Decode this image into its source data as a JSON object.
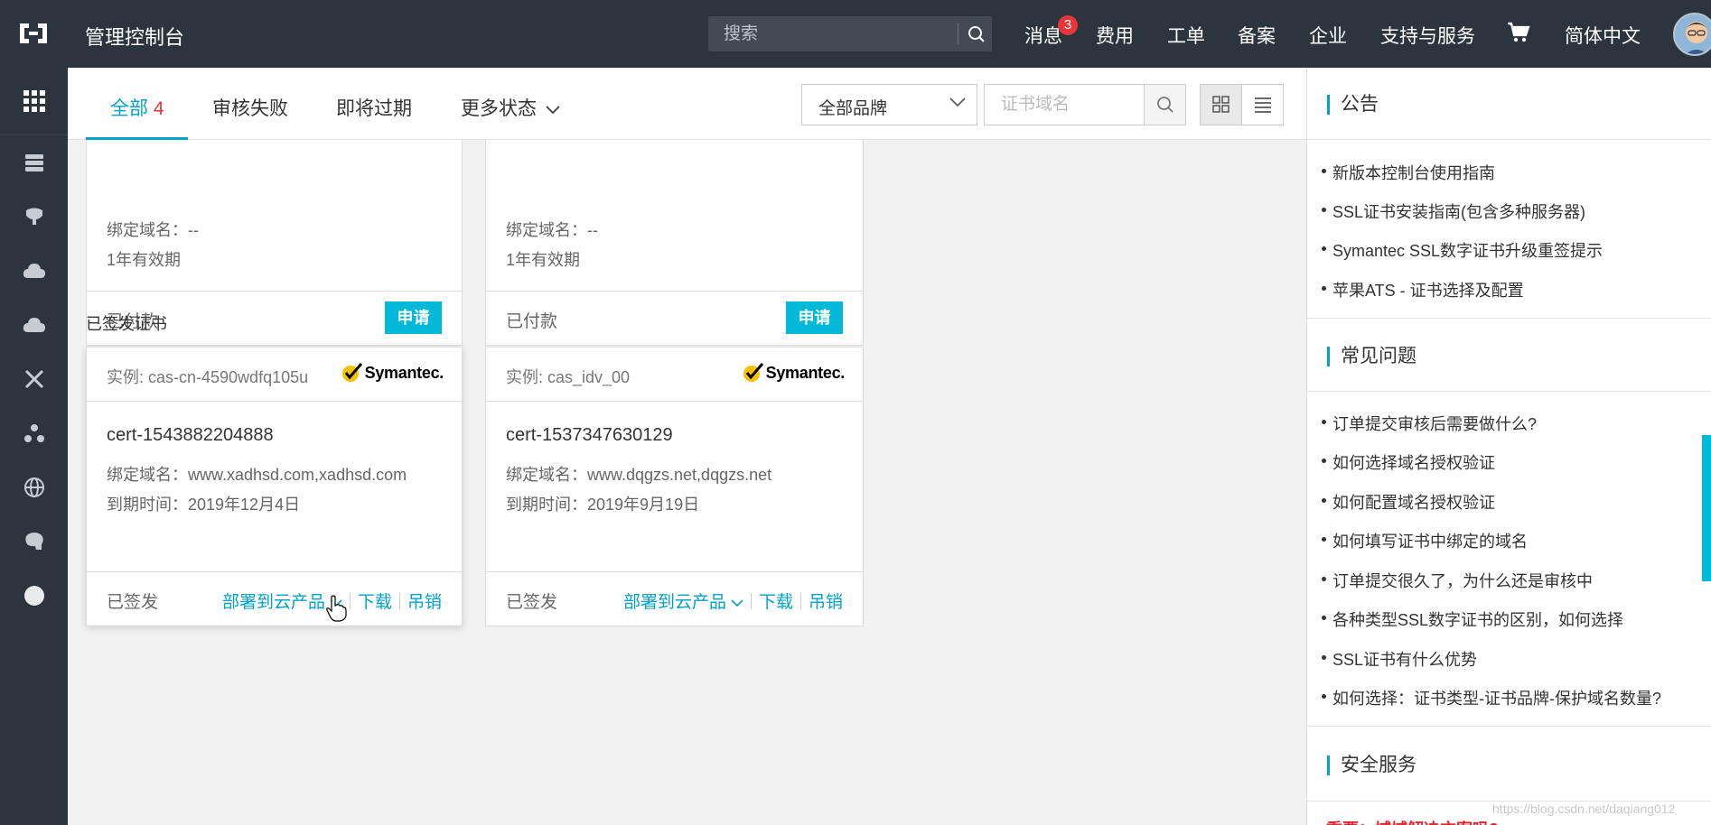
{
  "header": {
    "title": "管理控制台",
    "search_placeholder": "搜索",
    "nav": [
      "消息",
      "费用",
      "工单",
      "备案",
      "企业",
      "支持与服务",
      "简体中文"
    ],
    "message_count": "3"
  },
  "toolbar": {
    "tabs": [
      {
        "label": "全部",
        "count": "4"
      },
      {
        "label": "审核失败"
      },
      {
        "label": "即将过期"
      },
      {
        "label": "更多状态"
      }
    ],
    "brand_select": "全部品牌",
    "domain_placeholder": "证书域名"
  },
  "pending_cards": [
    {
      "domain_line": "绑定域名：--",
      "validity": "1年有效期",
      "status": "已付款",
      "action": "申请"
    },
    {
      "domain_line": "绑定域名：--",
      "validity": "1年有效期",
      "status": "已付款",
      "action": "申请"
    }
  ],
  "issued_section_label": "已签发证书",
  "issued_cards": [
    {
      "instance": "实例: cas-cn-4590wdfq105u",
      "brand": "Symantec.",
      "cert_name": "cert-1543882204888",
      "domain_line": "绑定域名：www.xadhsd.com,xadhsd.com",
      "expiry_line": "到期时间：2019年12月4日",
      "status": "已签发",
      "deploy": "部署到云产品",
      "download": "下载",
      "revoke": "吊销"
    },
    {
      "instance": "实例: cas_idv_00",
      "brand": "Symantec.",
      "cert_name": "cert-1537347630129",
      "domain_line": "绑定域名：www.dqgzs.net,dqgzs.net",
      "expiry_line": "到期时间：2019年9月19日",
      "status": "已签发",
      "deploy": "部署到云产品",
      "download": "下载",
      "revoke": "吊销"
    }
  ],
  "right_panel": {
    "announcements_title": "公告",
    "announcements": [
      "新版本控制台使用指南",
      "SSL证书安装指南(包含多种服务器)",
      "Symantec SSL数字证书升级重签提示",
      "苹果ATS - 证书选择及配置"
    ],
    "faq_title": "常见问题",
    "faq": [
      "订单提交审核后需要做什么?",
      "如何选择域名授权验证",
      "如何配置域名授权验证",
      "如何填写证书中绑定的域名",
      "订单提交很久了，为什么还是审核中",
      "各种类型SSL数字证书的区别，如何选择",
      "SSL证书有什么优势",
      "如何选择：证书类型-证书品牌-保护域名数量?"
    ],
    "security_title": "安全服务",
    "security_teaser": "重要：域域解决方案吗?"
  },
  "watermark": "https://blog.csdn.net/daqiang012",
  "colors": {
    "accent": "#00a2ca",
    "apply_button": "#00b9d9",
    "topbar": "#2c343d",
    "badge": "#e9353a"
  }
}
